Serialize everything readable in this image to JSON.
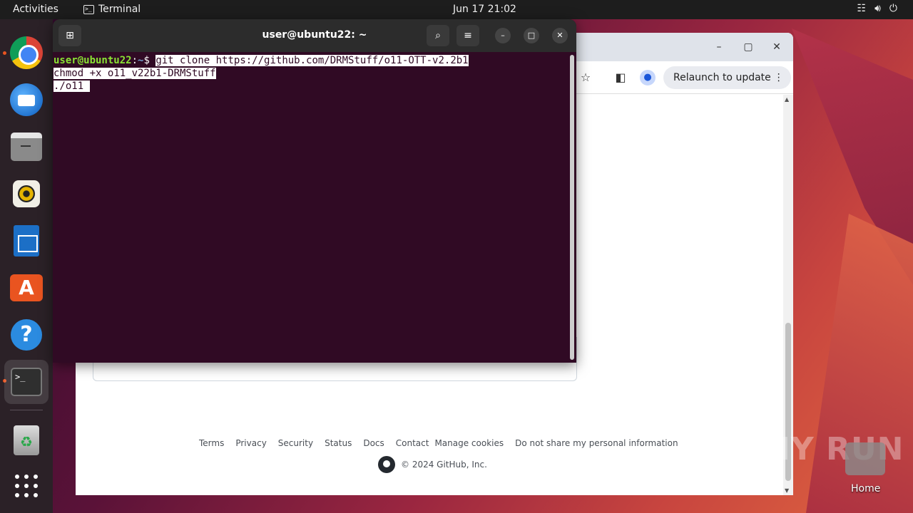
{
  "topbar": {
    "activities": "Activities",
    "app_name": "Terminal",
    "clock": "Jun 17  21:02",
    "icons": [
      "network-icon",
      "volume-icon",
      "power-icon"
    ]
  },
  "dock": {
    "items": [
      "chrome",
      "thunderbird",
      "files",
      "rhythmbox",
      "libreoffice-writer",
      "app-center",
      "help",
      "terminal",
      "trash",
      "show-apps"
    ]
  },
  "browser": {
    "relaunch_label": "Relaunch to update",
    "footer_links": [
      "Terms",
      "Privacy",
      "Security",
      "Status",
      "Docs",
      "Contact",
      "Manage cookies",
      "Do not share my personal information"
    ],
    "copyright": "© 2024 GitHub, Inc."
  },
  "terminal": {
    "title": "user@ubuntu22: ~",
    "prompt_user": "user@ubuntu22",
    "prompt_sep": ":",
    "prompt_path": "~",
    "prompt_symbol": "$ ",
    "lines": [
      "git clone https://github.com/DRMStuff/o11-OTT-v2.2b1",
      "chmod +x o11_v22b1-DRMStuff",
      "./o11 "
    ]
  },
  "desktop": {
    "watermark": "ANY RUN",
    "home_label": "Home"
  },
  "colors": {
    "terminal_bg": "#300a24",
    "prompt_user": "#8ae234",
    "prompt_path": "#729fcf",
    "ubuntu_orange": "#e95420"
  }
}
